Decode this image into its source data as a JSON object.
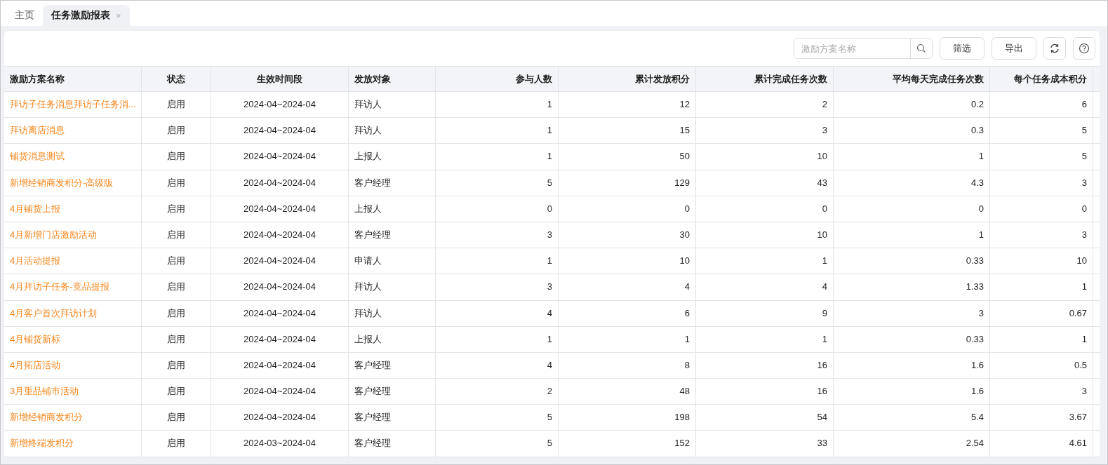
{
  "tabs": [
    {
      "label": "主页",
      "selected": false
    },
    {
      "label": "任务激励报表",
      "selected": true,
      "close": "×"
    }
  ],
  "toolbar": {
    "search": {
      "placeholder": "激励方案名称"
    },
    "buttons": [
      "筛选",
      "导出"
    ]
  },
  "table": {
    "columns": [
      "激励方案名称",
      "状态",
      "生效时间段",
      "发放对象",
      "参与人数",
      "累计发放积分",
      "累计完成任务次数",
      "平均每天完成任务次数",
      "每个任务成本积分"
    ],
    "rows": [
      [
        "拜访子任务消息拜访子任务消...",
        "启用",
        "2024-04~2024-04",
        "拜访人",
        "1",
        "12",
        "2",
        "0.2",
        "6"
      ],
      [
        "拜访离店消息",
        "启用",
        "2024-04~2024-04",
        "拜访人",
        "1",
        "15",
        "3",
        "0.3",
        "5"
      ],
      [
        "铺货消息测试",
        "启用",
        "2024-04~2024-04",
        "上报人",
        "1",
        "50",
        "10",
        "1",
        "5"
      ],
      [
        "新增经销商发积分-高级版",
        "启用",
        "2024-04~2024-04",
        "客户经理",
        "5",
        "129",
        "43",
        "4.3",
        "3"
      ],
      [
        "4月铺货上报",
        "启用",
        "2024-04~2024-04",
        "上报人",
        "0",
        "0",
        "0",
        "0",
        "0"
      ],
      [
        "4月新增门店激励活动",
        "启用",
        "2024-04~2024-04",
        "客户经理",
        "3",
        "30",
        "10",
        "1",
        "3"
      ],
      [
        "4月活动提报",
        "启用",
        "2024-04~2024-04",
        "申请人",
        "1",
        "10",
        "1",
        "0.33",
        "10"
      ],
      [
        "4月拜访子任务-竞品提报",
        "启用",
        "2024-04~2024-04",
        "拜访人",
        "3",
        "4",
        "4",
        "1.33",
        "1"
      ],
      [
        "4月客户首次拜访计划",
        "启用",
        "2024-04~2024-04",
        "拜访人",
        "4",
        "6",
        "9",
        "3",
        "0.67"
      ],
      [
        "4月铺货新标",
        "启用",
        "2024-04~2024-04",
        "上报人",
        "1",
        "1",
        "1",
        "0.33",
        "1"
      ],
      [
        "4月拓店活动",
        "启用",
        "2024-04~2024-04",
        "客户经理",
        "4",
        "8",
        "16",
        "1.6",
        "0.5"
      ],
      [
        "3月重品铺市活动",
        "启用",
        "2024-04~2024-04",
        "客户经理",
        "2",
        "48",
        "16",
        "1.6",
        "3"
      ],
      [
        "新增经销商发积分",
        "启用",
        "2024-04~2024-04",
        "客户经理",
        "5",
        "198",
        "54",
        "5.4",
        "3.67"
      ],
      [
        "新增终端发积分",
        "启用",
        "2024-03~2024-04",
        "客户经理",
        "5",
        "152",
        "33",
        "2.54",
        "4.61"
      ]
    ]
  }
}
